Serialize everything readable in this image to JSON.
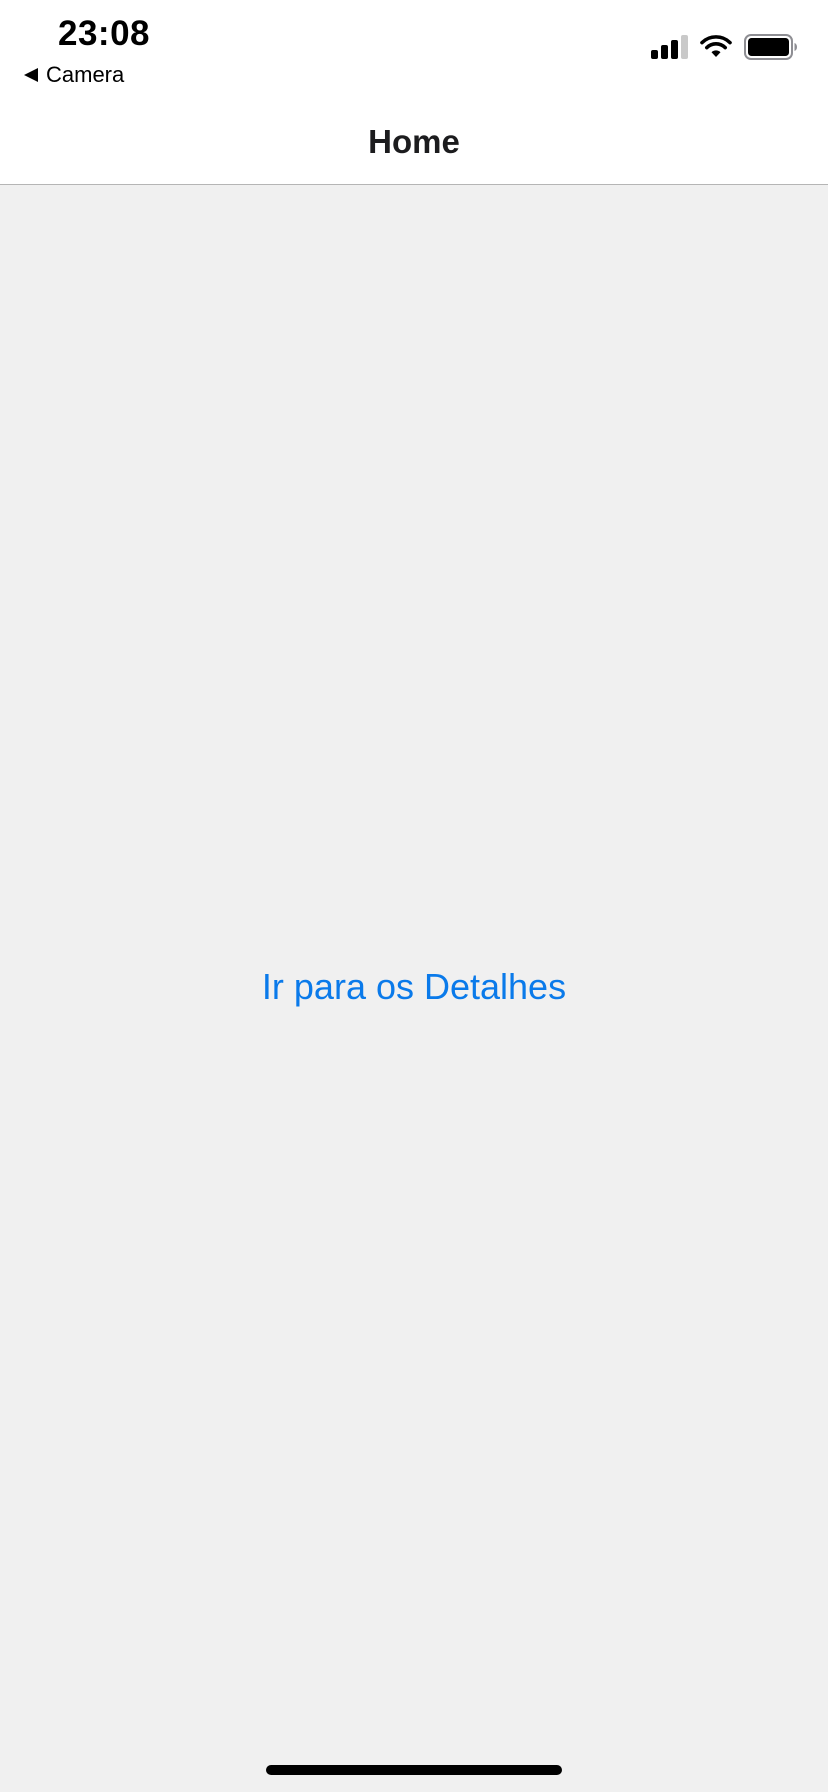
{
  "status_bar": {
    "time": "23:08",
    "back_app_label": "Camera",
    "icons": [
      "back-arrow-icon",
      "cellular-signal-icon",
      "wifi-icon",
      "battery-icon"
    ]
  },
  "nav_bar": {
    "title": "Home"
  },
  "main": {
    "link_label": "Ir para os Detalhes"
  },
  "colors": {
    "accent": "#0a7aea",
    "background": "#f0f0f0",
    "bar_background": "#ffffff"
  }
}
